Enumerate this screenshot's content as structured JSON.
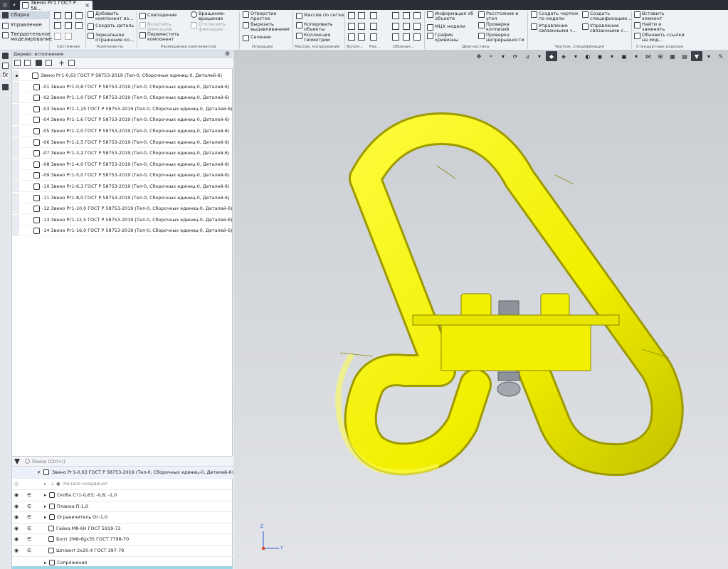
{
  "window": {
    "tab_title": "Звено Рг1 ГОСТ Р 58...",
    "close": "×"
  },
  "modes": [
    {
      "label": "Сборка",
      "selected": true
    },
    {
      "label": "Управление",
      "selected": false
    },
    {
      "label": "Твердотельное моделирование",
      "selected": false
    }
  ],
  "ribbon": {
    "buttons": {
      "add_component": "Добавить компонент из...",
      "create_part": "Создать деталь",
      "mirror": "Зеркальное отражение ко...",
      "coincide": "Совпадение",
      "enable_fix": "Включить фиксацию",
      "move_component": "Переместить компонент",
      "rotate": "Вращение-вращение",
      "disable_fix": "Отключить фиксацию",
      "hole": "Отверстие простое",
      "extrude_cut": "Вырезать выдавливанием",
      "section": "Сечение",
      "array_grid": "Массив по сетке",
      "copy_objects": "Копировать объекты",
      "geometry_collection": "Коллекция геометрии",
      "object_info": "Информация об объекте",
      "mcx": "МЦХ модели",
      "curvature_graph": "График кривизны",
      "distance_angle": "Расстояние и угол",
      "collision_check": "Проверка коллизий",
      "continuity_check": "Проверка непрерывности",
      "create_drawing": "Создать чертеж по модели",
      "manage_linked_1": "Управление связанными ч...",
      "create_spec": "Создать спецификацию...",
      "manage_linked_2": "Управление связанными с...",
      "insert_element": "Вставить элемент",
      "find_replace": "Найти и заменить",
      "update_links": "Обновить ссылки на мод..."
    },
    "groups": {
      "system": "Системная",
      "components": "Компоненты",
      "placement": "Размещение компонентов",
      "operations": "Операции",
      "array": "Массив, копирование",
      "aux": "Вспом...",
      "dims": "Раз...",
      "desig": "Обознач...",
      "diagnostics": "Диагностика",
      "drawing_spec": "Чертеж, спецификация",
      "std_parts": "Стандартные изделия"
    }
  },
  "tree": {
    "header": "Дерево: исполнения",
    "rows": [
      "Звено Рг1-0,63 ГОСТ Р 58753-2019 (Тел-0, Сборочных единиц-0, Деталей-6)",
      "-01 Звено Рг1-0,8 ГОСТ Р 58753-2019 (Тел-0, Сборочных единиц-0, Деталей-6)",
      "-02 Звено Рг1-1,0 ГОСТ Р 58753-2019 (Тел-0, Сборочных единиц-0, Деталей-6)",
      "-03 Звено Рг1-1,25 ГОСТ Р 58753-2019 (Тел-0, Сборочных единиц-0, Деталей-6)",
      "-04 Звено Рг1-1,6 ГОСТ Р 58753-2019 (Тел-0, Сборочных единиц-0, Деталей-6)",
      "-05 Звено Рг1-2,0 ГОСТ Р 58753-2019 (Тел-0, Сборочных единиц-0, Деталей-6)",
      "-06 Звено Рг1-2,5 ГОСТ Р 58753-2019 (Тел-0, Сборочных единиц-0, Деталей-6)",
      "-07 Звено Рг1-3,2 ГОСТ Р 58753-2019 (Тел-0, Сборочных единиц-0, Деталей-6)",
      "-08 Звено Рг1-4,0 ГОСТ Р 58753-2019 (Тел-0, Сборочных единиц-0, Деталей-6)",
      "-09 Звено Рг1-5,0 ГОСТ Р 58753-2019 (Тел-0, Сборочных единиц-0, Деталей-6)",
      "-10 Звено Рг1-6,3 ГОСТ Р 58753-2019 (Тел-0, Сборочных единиц-0, Деталей-6)",
      "-11 Звено Рг1-8,0 ГОСТ Р 58753-2019 (Тел-0, Сборочных единиц-0, Деталей-6)",
      "-12 Звено Рг1-10,0 ГОСТ Р 58753-2019 (Тел-0, Сборочных единиц-0, Деталей-6)",
      "-13 Звено Рг1-12,5 ГОСТ Р 58753-2019 (Тел-0, Сборочных единиц-0, Деталей-6)",
      "-14 Звено Рг1-16,0 ГОСТ Р 58753-2019 (Тел-0, Сборочных единиц-0, Деталей-6)"
    ]
  },
  "search": {
    "placeholder": "Поиск (Ctrl+/)"
  },
  "build_tree": {
    "root": "Звено Рг1-0,63 ГОСТ Р 58753-2019 (Тел-0, Сборочных единиц-0, Деталей-6)",
    "origin": "Начало координат",
    "items": [
      "Скоба Ст1-0,63; -0,8; -1,0",
      "Планка П-1,0",
      "Ограничитель Ог-1,0",
      "Гайка М8-6Н ГОСТ 5919-73",
      "Болт 2М8-6gх35 ГОСТ 7798-70",
      "Шплинт 2х20.4 ГОСТ 397-79"
    ],
    "mates": "Сопряжения"
  },
  "axes": {
    "z": "Z",
    "y": "Y"
  },
  "colors": {
    "part_yellow": "#f2ef00",
    "part_shadow": "#9d9a00",
    "bolt_gray": "#9aa0a6",
    "viewport_top": "#c8cbd0"
  }
}
